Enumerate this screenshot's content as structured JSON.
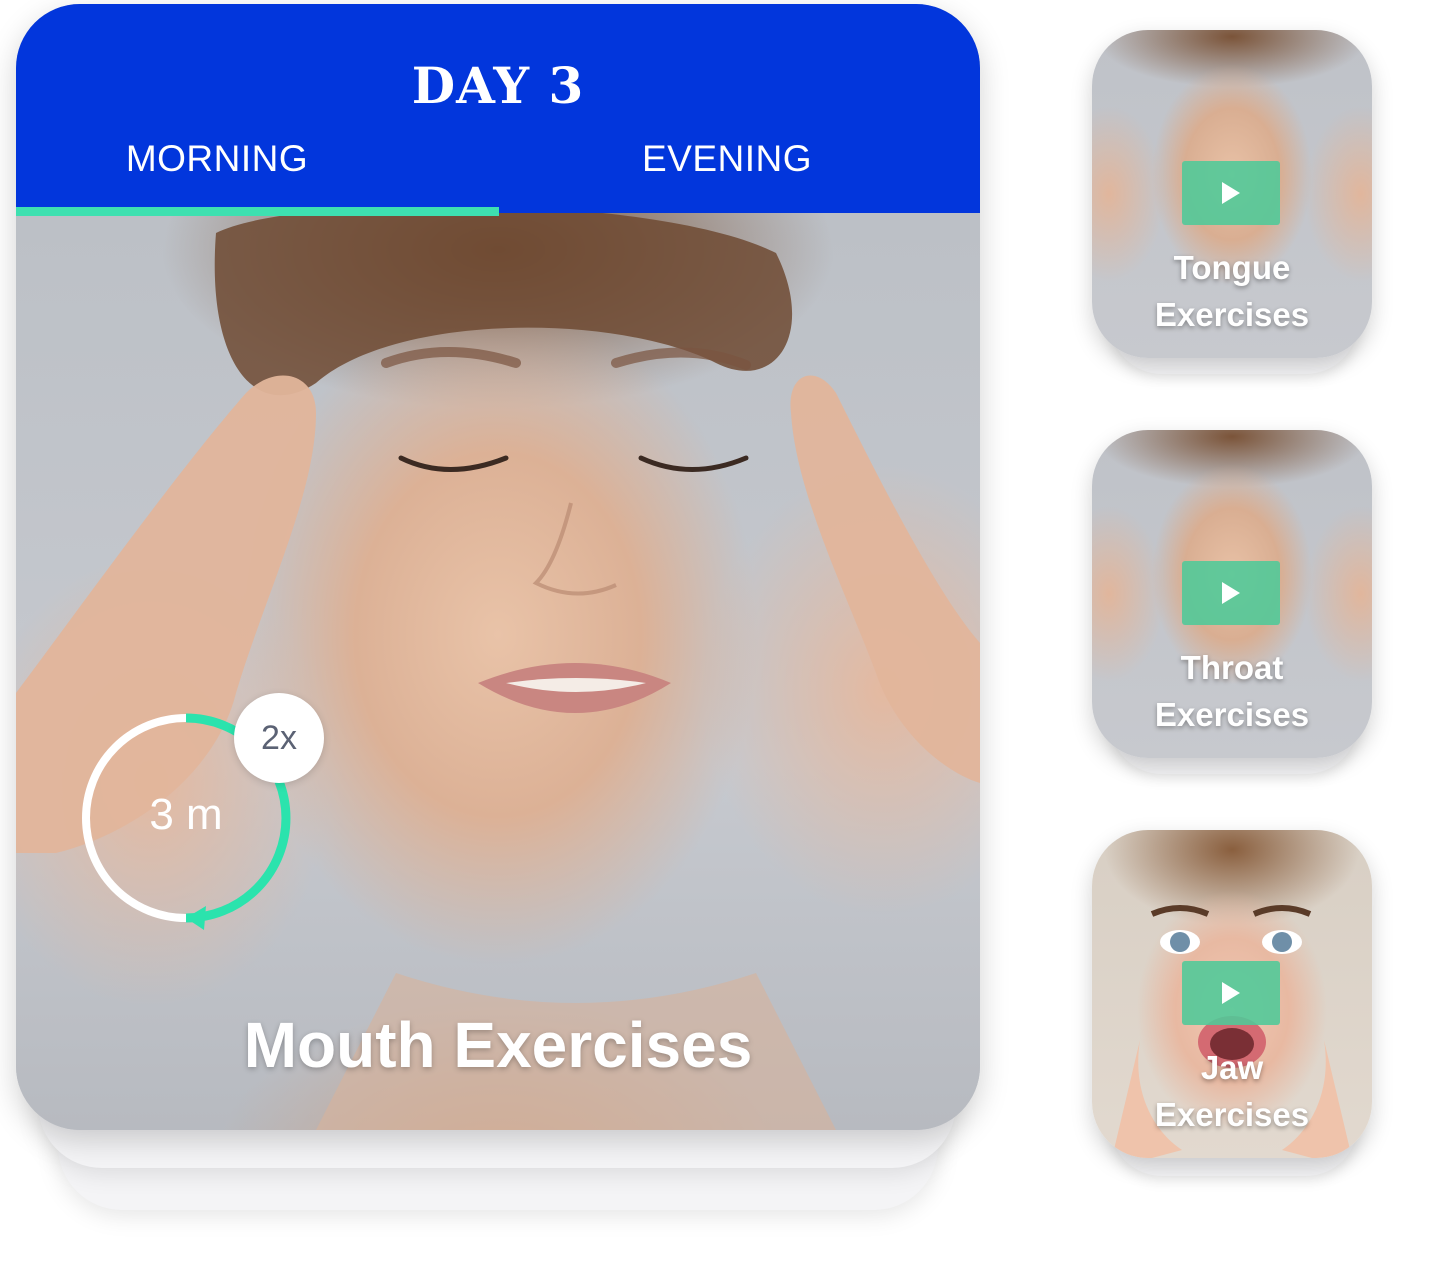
{
  "main_card": {
    "day_title": "DAY 3",
    "tabs": [
      {
        "label": "MORNING",
        "active": true
      },
      {
        "label": "EVENING",
        "active": false
      }
    ],
    "timer": {
      "duration_label": "3 m",
      "repeat_label": "2x",
      "progress": 0.5
    },
    "exercise_title": "Mouth Exercises"
  },
  "side_cards": [
    {
      "line1": "Tongue",
      "line2": "Exercises"
    },
    {
      "line1": "Throat",
      "line2": "Exercises"
    },
    {
      "line1": "Jaw",
      "line2": "Exercises"
    }
  ],
  "colors": {
    "header_blue": "#0236dc",
    "accent_green": "#3ee0b0",
    "play_green": "#4fc998",
    "badge_text": "#5b6274"
  },
  "icons": {
    "play": "play-icon",
    "timer": "timer-ring-icon"
  }
}
